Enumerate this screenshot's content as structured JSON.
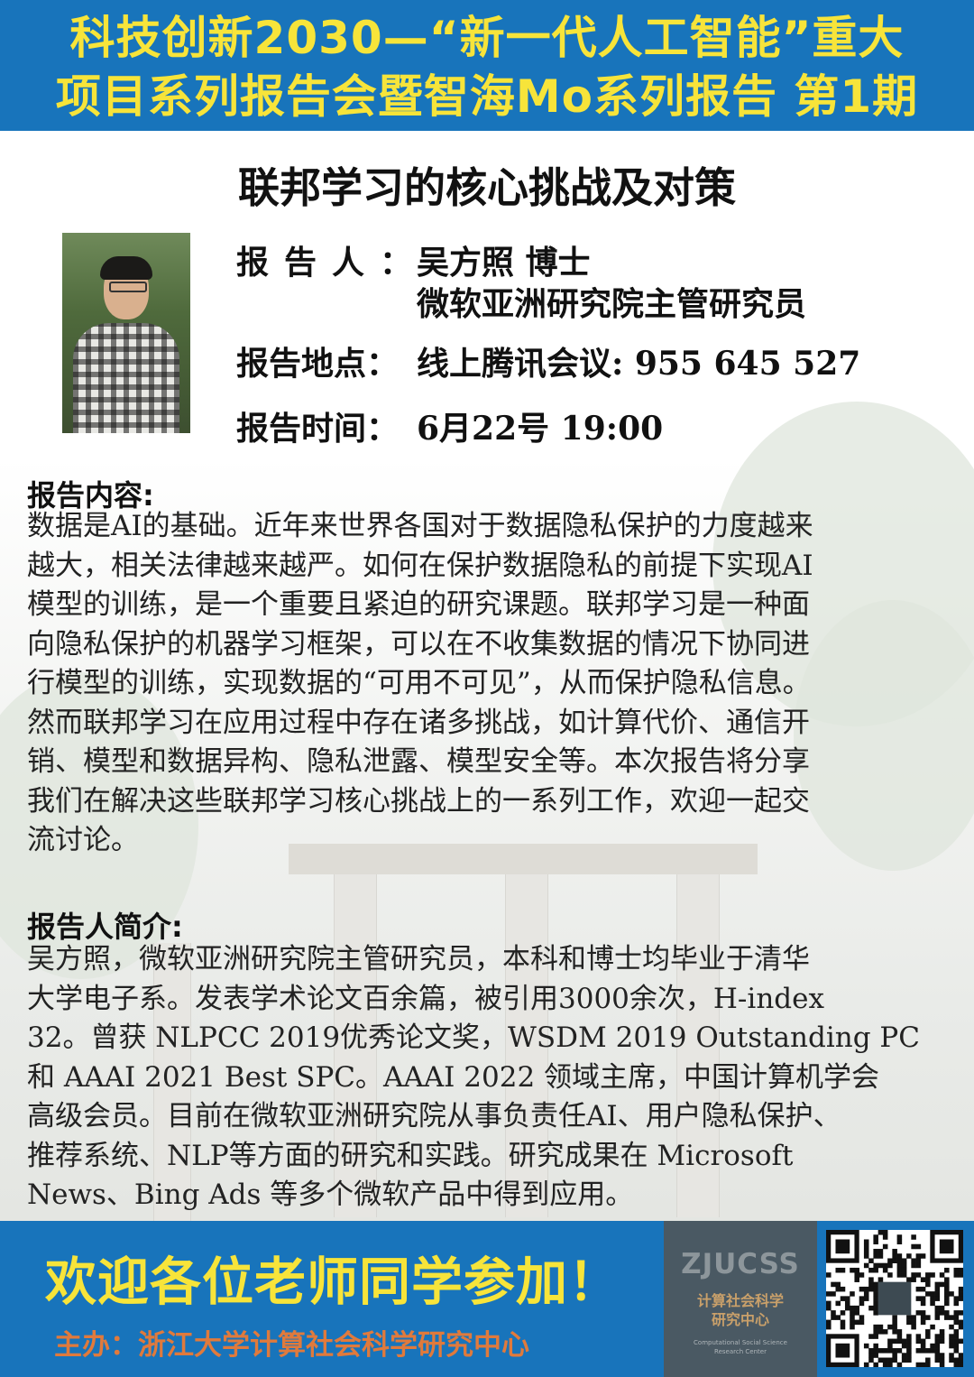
{
  "header": {
    "line1": "科技创新2030—“新一代人工智能”重大",
    "line2": "项目系列报告会暨智海Mo系列报告 第1期"
  },
  "title": "联邦学习的核心挑战及对策",
  "speaker": {
    "label": "报告人：",
    "name": "吴方照 博士",
    "affiliation": "微软亚洲研究院主管研究员"
  },
  "location": {
    "label": "报告地点：",
    "value": "线上腾讯会议: 955 645 527"
  },
  "time": {
    "label": "报告时间：",
    "value": "6月22号 19:00"
  },
  "abstract": {
    "heading": "报告内容:",
    "lines": [
      "数据是AI的基础。近年来世界各国对于数据隐私保护的力度越来",
      "越大，相关法律越来越严。如何在保护数据隐私的前提下实现AI",
      "模型的训练，是一个重要且紧迫的研究课题。联邦学习是一种面",
      "向隐私保护的机器学习框架，可以在不收集数据的情况下协同进",
      "行模型的训练，实现数据的“可用不可见”，从而保护隐私信息。",
      "然而联邦学习在应用过程中存在诸多挑战，如计算代价、通信开",
      "销、模型和数据异构、隐私泄露、模型安全等。本次报告将分享",
      "我们在解决这些联邦学习核心挑战上的一系列工作，欢迎一起交",
      "流讨论。"
    ]
  },
  "bio": {
    "heading": "报告人简介:",
    "lines": [
      "吴方照，微软亚洲研究院主管研究员，本科和博士均毕业于清华",
      "大学电子系。发表学术论文百余篇，被引用3000余次，H-index",
      "32。曾获 NLPCC 2019优秀论文奖，WSDM 2019 Outstanding PC",
      "和 AAAI 2021 Best SPC。AAAI 2022 领域主席，中国计算机学会",
      "高级会员。目前在微软亚洲研究院从事负责任AI、用户隐私保护、",
      "推荐系统、NLP等方面的研究和实践。研究成果在 Microsoft",
      "News、Bing Ads 等多个微软产品中得到应用。"
    ]
  },
  "footer": {
    "welcome": "欢迎各位老师同学参加！",
    "host": "主办：浙江大学计算社会科学研究中心",
    "logo_mark": "ZJUCSS",
    "logo_cn_1": "计算社会科学",
    "logo_cn_2": "研究中心",
    "logo_en_1": "Computational Social Science",
    "logo_en_2": "Research Center"
  },
  "icons": {
    "qr": "qr-code-icon",
    "photo": "speaker-photo"
  },
  "colors": {
    "banner_blue": "#1874bb",
    "banner_yellow": "#f7e43a",
    "host_orange": "#e07a3c",
    "logo_gray": "#4a5963"
  }
}
